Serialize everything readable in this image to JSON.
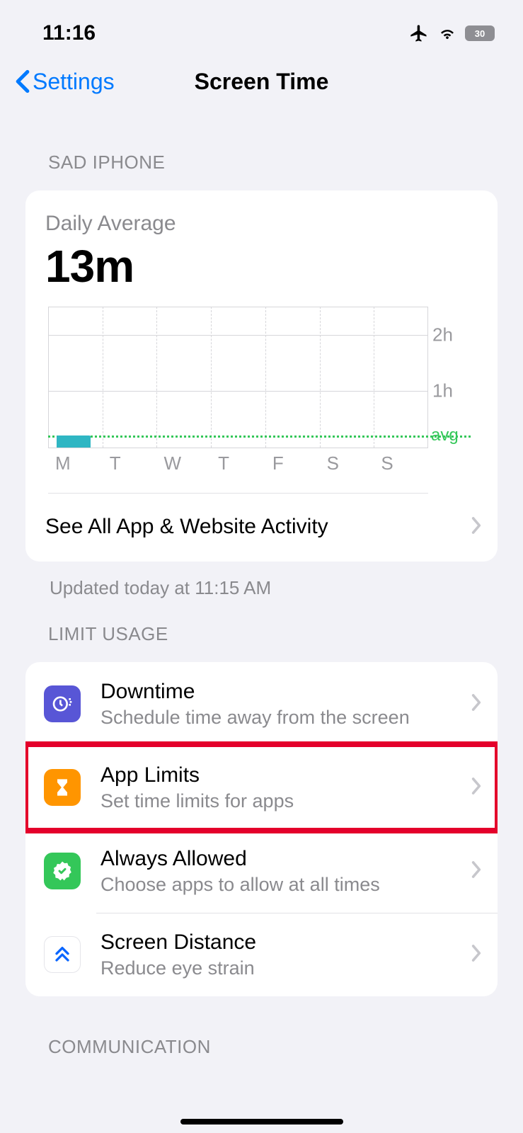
{
  "status": {
    "time": "11:16",
    "battery_percent": "30"
  },
  "nav": {
    "back_label": "Settings",
    "title": "Screen Time"
  },
  "sections": {
    "device": "SAD IPHONE",
    "limit_usage": "LIMIT USAGE",
    "communication": "COMMUNICATION"
  },
  "summary": {
    "daily_label": "Daily Average",
    "daily_value": "13m",
    "see_all_label": "See All App & Website Activity",
    "updated_label": "Updated today at 11:15 AM"
  },
  "chart_data": {
    "type": "bar",
    "categories": [
      "M",
      "T",
      "W",
      "T",
      "F",
      "S",
      "S"
    ],
    "values": [
      13,
      0,
      0,
      0,
      0,
      0,
      0
    ],
    "unit": "minutes",
    "ylabel": "",
    "xlabel": "",
    "ylim": [
      0,
      150
    ],
    "ticks": [
      {
        "value": 60,
        "label": "1h"
      },
      {
        "value": 120,
        "label": "2h"
      }
    ],
    "avg_line": {
      "value": 13,
      "label": "avg"
    }
  },
  "limit_items": [
    {
      "title": "Downtime",
      "subtitle": "Schedule time away from the screen",
      "icon": "downtime",
      "highlighted": false
    },
    {
      "title": "App Limits",
      "subtitle": "Set time limits for apps",
      "icon": "hourglass",
      "highlighted": true
    },
    {
      "title": "Always Allowed",
      "subtitle": "Choose apps to allow at all times",
      "icon": "check-badge",
      "highlighted": false
    },
    {
      "title": "Screen Distance",
      "subtitle": "Reduce eye strain",
      "icon": "chevrons-up",
      "highlighted": false
    }
  ]
}
